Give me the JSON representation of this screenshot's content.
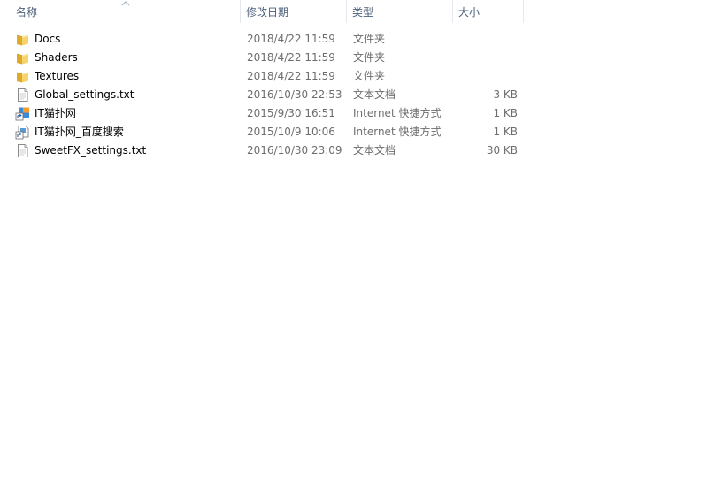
{
  "columns": {
    "name": "名称",
    "date": "修改日期",
    "type": "类型",
    "size": "大小"
  },
  "files": [
    {
      "name": "Docs",
      "date": "2018/4/22 11:59",
      "type": "文件夹",
      "size": "",
      "icon": "folder-icon"
    },
    {
      "name": "Shaders",
      "date": "2018/4/22 11:59",
      "type": "文件夹",
      "size": "",
      "icon": "folder-icon"
    },
    {
      "name": "Textures",
      "date": "2018/4/22 11:59",
      "type": "文件夹",
      "size": "",
      "icon": "folder-icon"
    },
    {
      "name": "Global_settings.txt",
      "date": "2016/10/30 22:53",
      "type": "文本文档",
      "size": "3 KB",
      "icon": "text-file-icon"
    },
    {
      "name": "IT猫扑网",
      "date": "2015/9/30 16:51",
      "type": "Internet 快捷方式",
      "size": "1 KB",
      "icon": "internet-shortcut-icon"
    },
    {
      "name": "IT猫扑网_百度搜索",
      "date": "2015/10/9 10:06",
      "type": "Internet 快捷方式",
      "size": "1 KB",
      "icon": "internet-shortcut-icon"
    },
    {
      "name": "SweetFX_settings.txt",
      "date": "2016/10/30 23:09",
      "type": "文本文档",
      "size": "30 KB",
      "icon": "text-file-icon"
    }
  ]
}
